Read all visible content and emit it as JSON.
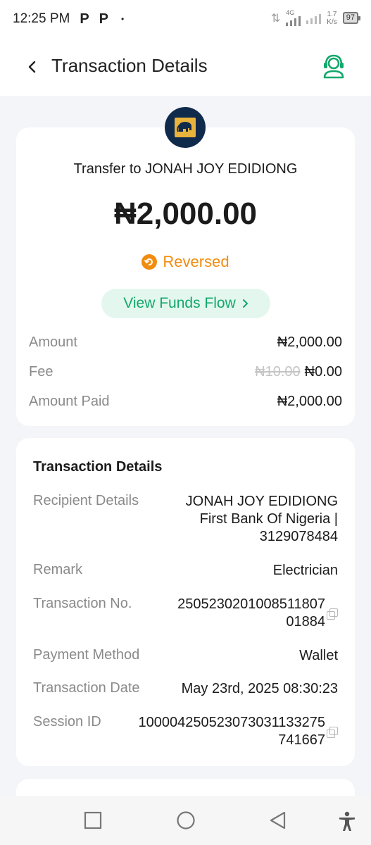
{
  "status_bar": {
    "time": "12:25 PM",
    "notif1": "P",
    "notif2": "P",
    "dot": "•",
    "network": "4G",
    "speed_value": "1.7",
    "speed_unit": "K/s",
    "battery": "97"
  },
  "header": {
    "title": "Transaction Details"
  },
  "summary": {
    "transfer_title": "Transfer to JONAH JOY EDIDIONG",
    "amount": "₦2,000.00",
    "status": "Reversed",
    "funds_flow_label": "View Funds Flow",
    "rows": [
      {
        "label": "Amount",
        "value": "₦2,000.00"
      },
      {
        "label": "Fee",
        "old_value": "₦10.00",
        "value": "₦0.00"
      },
      {
        "label": "Amount Paid",
        "value": "₦2,000.00"
      }
    ]
  },
  "details": {
    "title": "Transaction Details",
    "rows": [
      {
        "label": "Recipient Details",
        "lines": [
          "JONAH JOY EDIDIONG",
          "First Bank Of Nigeria |",
          "3129078484"
        ]
      },
      {
        "label": "Remark",
        "lines": [
          "Electrician"
        ]
      },
      {
        "label": "Transaction No.",
        "lines": [
          "250523020100851180​7",
          "01884"
        ]
      },
      {
        "label": "Payment Method",
        "lines": [
          "Wallet"
        ]
      },
      {
        "label": "Transaction Date",
        "lines": [
          "May 23rd, 2025 08:30:23"
        ]
      },
      {
        "label": "Session ID",
        "lines": [
          "1000042505230730311332​75",
          "741667"
        ]
      }
    ]
  },
  "colors": {
    "accent_green": "#12a86b",
    "status_orange": "#f28c0f",
    "logo_navy": "#102a4c"
  }
}
